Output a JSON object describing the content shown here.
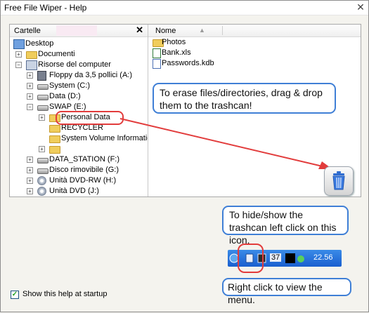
{
  "window": {
    "title": "Free File Wiper - Help",
    "close_label": "✕"
  },
  "folders_panel": {
    "header": "Cartelle",
    "close_label": "✕"
  },
  "tree": [
    {
      "label": "Desktop",
      "icon": "desktop-icon"
    },
    {
      "label": "Documenti",
      "icon": "folder-icon"
    },
    {
      "label": "Risorse del computer",
      "icon": "computer-icon"
    },
    {
      "label": "Floppy da 3,5 pollici (A:)",
      "icon": "floppy-icon"
    },
    {
      "label": "System (C:)",
      "icon": "drive-icon"
    },
    {
      "label": "Data (D:)",
      "icon": "drive-icon"
    },
    {
      "label": "SWAP (E:)",
      "icon": "drive-icon"
    },
    {
      "label": "Personal Data",
      "icon": "folder-icon"
    },
    {
      "label": "RECYCLER",
      "icon": "folder-icon"
    },
    {
      "label": "System Volume Informatic",
      "icon": "folder-icon"
    },
    {
      "label": "",
      "icon": "folder-icon"
    },
    {
      "label": "DATA_STATION (F:)",
      "icon": "drive-icon"
    },
    {
      "label": "Disco rimovibile (G:)",
      "icon": "drive-icon"
    },
    {
      "label": "Unità DVD-RW (H:)",
      "icon": "cd-icon"
    },
    {
      "label": "Unità DVD (J:)",
      "icon": "cd-icon"
    }
  ],
  "files_panel": {
    "header": "Nome",
    "sort_indicator": "▲",
    "files": [
      {
        "label": "Photos",
        "icon": "folder-icon"
      },
      {
        "label": "Bank.xls",
        "icon": "excel-file-icon"
      },
      {
        "label": "Passwords.kdb",
        "icon": "keepass-file-icon"
      }
    ]
  },
  "callouts": {
    "drag_drop": "To erase files/directories, drag & drop them to the trashcan!",
    "hide_show": "To hide/show the trashcan left click on this icon.",
    "right_click": "Right click to view the menu."
  },
  "taskbar": {
    "tray_number": "37",
    "clock": "22.56"
  },
  "footer": {
    "show_help_label": "Show this help at startup",
    "checked": true
  },
  "colors": {
    "accent": "#3f7fd6",
    "highlight": "#e23c3c",
    "taskbar": "#2a75dc"
  }
}
